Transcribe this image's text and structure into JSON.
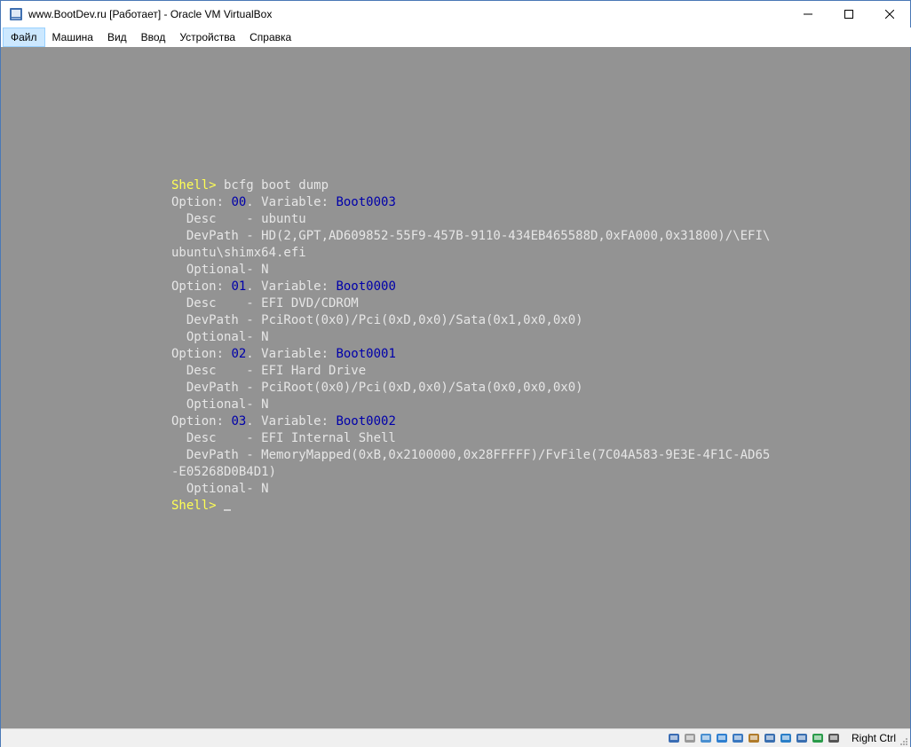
{
  "window": {
    "title": "www.BootDev.ru [Работает] - Oracle VM VirtualBox",
    "controls": {
      "minimize": "minimize-icon",
      "maximize": "maximize-icon",
      "close": "close-icon"
    }
  },
  "menu": [
    "Файл",
    "Машина",
    "Вид",
    "Ввод",
    "Устройства",
    "Справка"
  ],
  "console": {
    "lines": [
      [
        {
          "t": "Shell>",
          "c": "yellow"
        },
        {
          "t": " bcfg boot dump"
        }
      ],
      [
        {
          "t": "Option: "
        },
        {
          "t": "00",
          "c": "blue"
        },
        {
          "t": ". Variable: "
        },
        {
          "t": "Boot0003",
          "c": "blue"
        }
      ],
      [
        {
          "t": "  Desc    - ubuntu"
        }
      ],
      [
        {
          "t": "  DevPath - HD(2,GPT,AD609852-55F9-457B-9110-434EB465588D,0xFA000,0x31800)/\\EFI\\"
        }
      ],
      [
        {
          "t": "ubuntu\\shimx64.efi"
        }
      ],
      [
        {
          "t": "  Optional- N"
        }
      ],
      [
        {
          "t": "Option: "
        },
        {
          "t": "01",
          "c": "blue"
        },
        {
          "t": ". Variable: "
        },
        {
          "t": "Boot0000",
          "c": "blue"
        }
      ],
      [
        {
          "t": "  Desc    - EFI DVD/CDROM"
        }
      ],
      [
        {
          "t": "  DevPath - PciRoot(0x0)/Pci(0xD,0x0)/Sata(0x1,0x0,0x0)"
        }
      ],
      [
        {
          "t": "  Optional- N"
        }
      ],
      [
        {
          "t": "Option: "
        },
        {
          "t": "02",
          "c": "blue"
        },
        {
          "t": ". Variable: "
        },
        {
          "t": "Boot0001",
          "c": "blue"
        }
      ],
      [
        {
          "t": "  Desc    - EFI Hard Drive"
        }
      ],
      [
        {
          "t": "  DevPath - PciRoot(0x0)/Pci(0xD,0x0)/Sata(0x0,0x0,0x0)"
        }
      ],
      [
        {
          "t": "  Optional- N"
        }
      ],
      [
        {
          "t": "Option: "
        },
        {
          "t": "03",
          "c": "blue"
        },
        {
          "t": ". Variable: "
        },
        {
          "t": "Boot0002",
          "c": "blue"
        }
      ],
      [
        {
          "t": "  Desc    - EFI Internal Shell"
        }
      ],
      [
        {
          "t": "  DevPath - MemoryMapped(0xB,0x2100000,0x28FFFFF)/FvFile(7C04A583-9E3E-4F1C-AD65"
        }
      ],
      [
        {
          "t": "-E05268D0B4D1)"
        }
      ],
      [
        {
          "t": "  Optional- N"
        }
      ],
      [
        {
          "t": "Shell>",
          "c": "yellow"
        },
        {
          "t": " "
        },
        {
          "cursor": true
        }
      ]
    ]
  },
  "statusbar": {
    "icons": [
      "hard-disk-icon",
      "optical-drive-icon",
      "audio-icon",
      "network-icon",
      "usb-icon",
      "shared-folders-icon",
      "display-icon",
      "video-capture-icon",
      "cpu-icon",
      "mouse-integration-icon",
      "keyboard-icon"
    ],
    "host_key": "Right Ctrl"
  }
}
